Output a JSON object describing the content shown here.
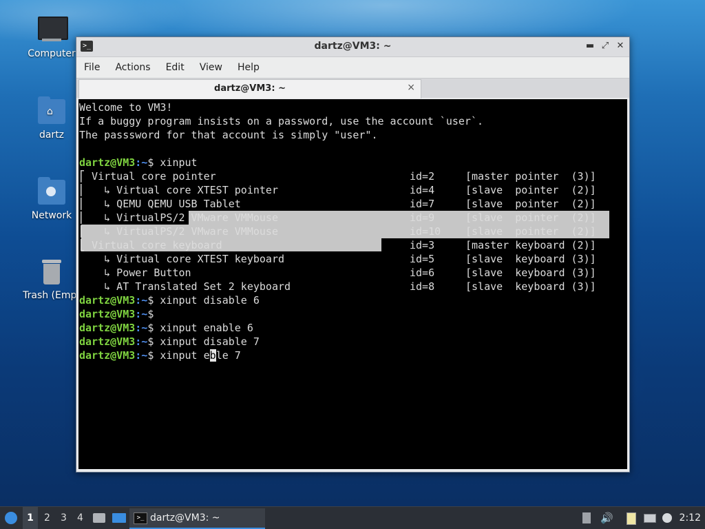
{
  "desktop": {
    "icons": [
      {
        "label": "Computer",
        "icon": "monitor-icon"
      },
      {
        "label": "dartz",
        "icon": "home-folder-icon"
      },
      {
        "label": "Network",
        "icon": "network-folder-icon"
      },
      {
        "label": "Trash (Empt",
        "icon": "trash-icon"
      }
    ]
  },
  "window": {
    "title": "dartz@VM3: ~",
    "controls": {
      "minimize": "▬",
      "maximize": "⤢",
      "close": "✕"
    },
    "menu": [
      "File",
      "Actions",
      "Edit",
      "View",
      "Help"
    ],
    "tab": {
      "title": "dartz@VM3: ~",
      "close": "×"
    }
  },
  "terminal": {
    "prompt_user": "dartz@VM3",
    "prompt_path": ":~",
    "prompt_end": "$ ",
    "welcome": [
      "Welcome to VM3!",
      "If a buggy program insists on a password, use the account `user`.",
      "The passsword for that account is simply \"user\"."
    ],
    "cmd_xinput": "xinput",
    "device_rows": [
      {
        "name": "⎡ Virtual core pointer",
        "id": "id=2",
        "role": "[master pointer  (3)]"
      },
      {
        "name": "⎜   ↳ Virtual core XTEST pointer",
        "id": "id=4",
        "role": "[slave  pointer  (2)]"
      },
      {
        "name": "⎜   ↳ QEMU QEMU USB Tablet",
        "id": "id=7",
        "role": "[slave  pointer  (2)]"
      },
      {
        "name": "⎜   ↳ VirtualPS/2 VMware VMMouse",
        "id": "id=9",
        "role": "[slave  pointer  (2)]"
      },
      {
        "name": "⎜   ↳ VirtualPS/2 VMware VMMouse",
        "id": "id=10",
        "role": "[slave  pointer  (2)]"
      },
      {
        "name": "⎣ Virtual core keyboard",
        "id": "id=3",
        "role": "[master keyboard (2)]"
      },
      {
        "name": "    ↳ Virtual core XTEST keyboard",
        "id": "id=5",
        "role": "[slave  keyboard (3)]"
      },
      {
        "name": "    ↳ Power Button",
        "id": "id=6",
        "role": "[slave  keyboard (3)]"
      },
      {
        "name": "    ↳ AT Translated Set 2 keyboard",
        "id": "id=8",
        "role": "[slave  keyboard (3)]"
      }
    ],
    "history": [
      "xinput disable 6",
      "",
      "xinput enable 6",
      "xinput disable 7"
    ],
    "current_input_before": "xinput e",
    "current_input_cursor": "b",
    "current_input_after": "le 7"
  },
  "taskbar": {
    "workspaces": [
      "1",
      "2",
      "3",
      "4"
    ],
    "active_workspace": "1",
    "task_label": "dartz@VM3: ~",
    "clock": "2:12",
    "tray_icons": [
      "eject-icon",
      "volume-icon",
      "clipboard-icon",
      "network-icon",
      "notification-icon"
    ]
  }
}
